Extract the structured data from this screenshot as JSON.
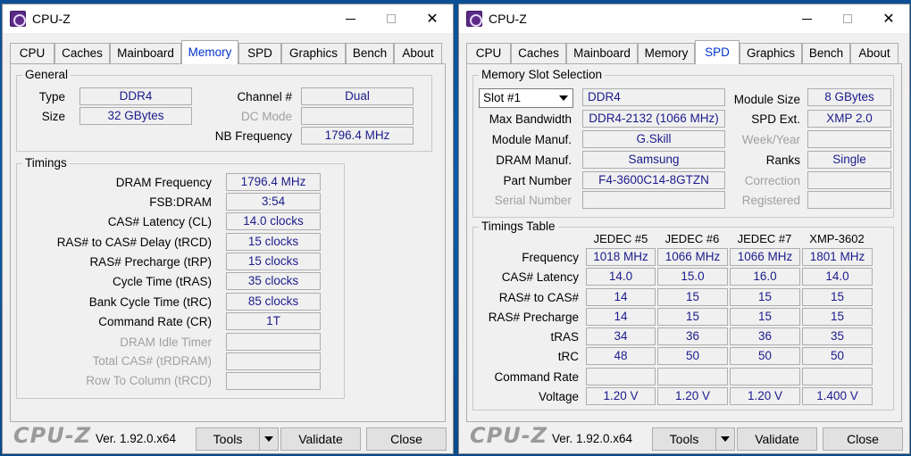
{
  "windows": [
    {
      "title": "CPU-Z",
      "tabs": [
        "CPU",
        "Caches",
        "Mainboard",
        "Memory",
        "SPD",
        "Graphics",
        "Bench",
        "About"
      ],
      "active_tab": "Memory",
      "general": {
        "title": "General",
        "type_label": "Type",
        "type_value": "DDR4",
        "size_label": "Size",
        "size_value": "32 GBytes",
        "channel_label": "Channel #",
        "channel_value": "Dual",
        "dcmode_label": "DC Mode",
        "dcmode_value": "",
        "nbfreq_label": "NB Frequency",
        "nbfreq_value": "1796.4 MHz"
      },
      "timings": {
        "title": "Timings",
        "rows": [
          {
            "label": "DRAM Frequency",
            "value": "1796.4 MHz",
            "disabled": false
          },
          {
            "label": "FSB:DRAM",
            "value": "3:54",
            "disabled": false
          },
          {
            "label": "CAS# Latency (CL)",
            "value": "14.0 clocks",
            "disabled": false
          },
          {
            "label": "RAS# to CAS# Delay (tRCD)",
            "value": "15 clocks",
            "disabled": false
          },
          {
            "label": "RAS# Precharge (tRP)",
            "value": "15 clocks",
            "disabled": false
          },
          {
            "label": "Cycle Time (tRAS)",
            "value": "35 clocks",
            "disabled": false
          },
          {
            "label": "Bank Cycle Time (tRC)",
            "value": "85 clocks",
            "disabled": false
          },
          {
            "label": "Command Rate (CR)",
            "value": "1T",
            "disabled": false
          },
          {
            "label": "DRAM Idle Timer",
            "value": "",
            "disabled": true
          },
          {
            "label": "Total CAS# (tRDRAM)",
            "value": "",
            "disabled": true
          },
          {
            "label": "Row To Column (tRCD)",
            "value": "",
            "disabled": true
          }
        ]
      },
      "footer": {
        "brand": "CPU-Z",
        "version": "Ver. 1.92.0.x64",
        "tools": "Tools",
        "validate": "Validate",
        "close": "Close"
      }
    },
    {
      "title": "CPU-Z",
      "tabs": [
        "CPU",
        "Caches",
        "Mainboard",
        "Memory",
        "SPD",
        "Graphics",
        "Bench",
        "About"
      ],
      "active_tab": "SPD",
      "slot": {
        "title": "Memory Slot Selection",
        "selected": "Slot #1",
        "type_value": "DDR4",
        "module_size_label": "Module Size",
        "module_size_value": "8 GBytes",
        "max_bw_label": "Max Bandwidth",
        "max_bw_value": "DDR4-2132 (1066 MHz)",
        "spd_ext_label": "SPD Ext.",
        "spd_ext_value": "XMP 2.0",
        "manuf_label": "Module Manuf.",
        "manuf_value": "G.Skill",
        "weekyear_label": "Week/Year",
        "weekyear_value": "",
        "dram_manuf_label": "DRAM Manuf.",
        "dram_manuf_value": "Samsung",
        "ranks_label": "Ranks",
        "ranks_value": "Single",
        "part_label": "Part Number",
        "part_value": "F4-3600C14-8GTZN",
        "correction_label": "Correction",
        "correction_value": "",
        "serial_label": "Serial Number",
        "serial_value": "",
        "registered_label": "Registered",
        "registered_value": ""
      },
      "timings_table": {
        "title": "Timings Table",
        "columns": [
          "JEDEC #5",
          "JEDEC #6",
          "JEDEC #7",
          "XMP-3602"
        ],
        "rows": [
          {
            "label": "Frequency",
            "values": [
              "1018 MHz",
              "1066 MHz",
              "1066 MHz",
              "1801 MHz"
            ]
          },
          {
            "label": "CAS# Latency",
            "values": [
              "14.0",
              "15.0",
              "16.0",
              "14.0"
            ]
          },
          {
            "label": "RAS# to CAS#",
            "values": [
              "14",
              "15",
              "15",
              "15"
            ]
          },
          {
            "label": "RAS# Precharge",
            "values": [
              "14",
              "15",
              "15",
              "15"
            ]
          },
          {
            "label": "tRAS",
            "values": [
              "34",
              "36",
              "36",
              "35"
            ]
          },
          {
            "label": "tRC",
            "values": [
              "48",
              "50",
              "50",
              "50"
            ]
          },
          {
            "label": "Command Rate",
            "values": [
              "",
              "",
              "",
              ""
            ]
          },
          {
            "label": "Voltage",
            "values": [
              "1.20 V",
              "1.20 V",
              "1.20 V",
              "1.400 V"
            ]
          }
        ]
      },
      "footer": {
        "brand": "CPU-Z",
        "version": "Ver. 1.92.0.x64",
        "tools": "Tools",
        "validate": "Validate",
        "close": "Close"
      }
    }
  ],
  "colors": {
    "value_text": "#1b1b8c",
    "active_tab_text": "#0033cc",
    "desktop": "#0d5aa8"
  }
}
